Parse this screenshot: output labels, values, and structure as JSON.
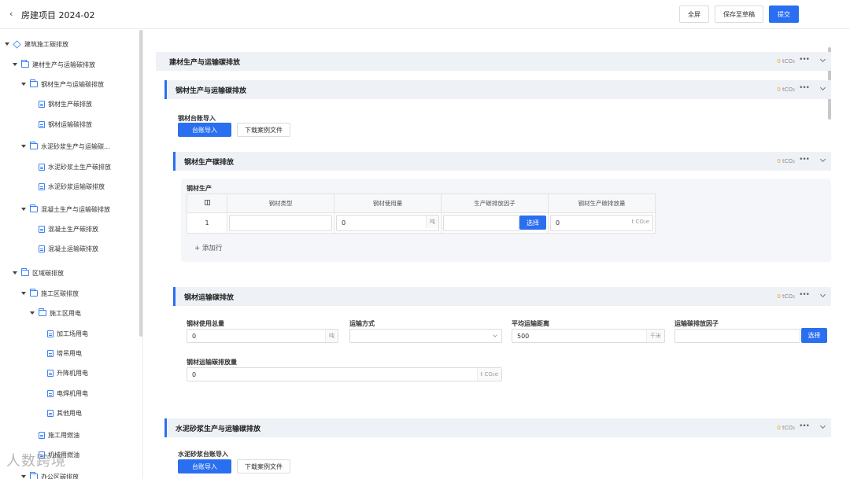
{
  "header": {
    "back_icon": "chevron-left-icon",
    "title": "房建项目 2024-02",
    "fullscreen_label": "全屏",
    "save_draft_label": "保存至草稿",
    "submit_label": "提交",
    "primary_color": "#2a6ff0"
  },
  "sidebar": {
    "items": [
      {
        "label": "建筑施工碳排放",
        "icon": "cube-icon",
        "caret": true
      },
      {
        "label": "建材生产与运输碳排放",
        "icon": "folder-icon",
        "caret": true
      },
      {
        "label": "钢材生产与运输碳排放",
        "icon": "folder-icon",
        "caret": true
      },
      {
        "label": "钢材生产碳排放",
        "icon": "document-icon",
        "caret": false
      },
      {
        "label": "钢材运输碳排放",
        "icon": "document-icon",
        "caret": false
      },
      {
        "label": "水泥砂浆生产与运输碳...",
        "icon": "folder-icon",
        "caret": true
      },
      {
        "label": "水泥砂浆土生产碳排放",
        "icon": "document-icon",
        "caret": false
      },
      {
        "label": "水泥砂浆运输碳排放",
        "icon": "document-icon",
        "caret": false
      },
      {
        "label": "混凝土生产与运输碳排放",
        "icon": "folder-icon",
        "caret": true
      },
      {
        "label": "混凝土生产碳排放",
        "icon": "document-icon",
        "caret": false
      },
      {
        "label": "混凝土运输碳排放",
        "icon": "document-icon",
        "caret": false
      },
      {
        "label": "区域碳排放",
        "icon": "folder-icon",
        "caret": true
      },
      {
        "label": "施工区碳排放",
        "icon": "folder-icon",
        "caret": true
      },
      {
        "label": "施工区用电",
        "icon": "folder-icon",
        "caret": true
      },
      {
        "label": "加工场用电",
        "icon": "document-icon",
        "caret": false
      },
      {
        "label": "塔吊用电",
        "icon": "document-icon",
        "caret": false
      },
      {
        "label": "升降机用电",
        "icon": "document-icon",
        "caret": false
      },
      {
        "label": "电焊机用电",
        "icon": "document-icon",
        "caret": false
      },
      {
        "label": "其他用电",
        "icon": "document-icon",
        "caret": false
      },
      {
        "label": "施工用燃油",
        "icon": "document-icon",
        "caret": false
      },
      {
        "label": "机械用燃油",
        "icon": "document-icon",
        "caret": false
      },
      {
        "label": "办公区碳排放",
        "icon": "folder-icon",
        "caret": true
      }
    ]
  },
  "sections": {
    "s1": {
      "title": "建材生产与运输碳排放",
      "total": "0",
      "unit": "tCO₂"
    },
    "s2": {
      "title": "钢材生产与运输碳排放",
      "total": "0",
      "unit": "tCO₂"
    },
    "s3": {
      "title": "钢材生产碳排放",
      "total": "0",
      "unit": "tCO₂"
    },
    "s4": {
      "title": "钢材运输碳排放",
      "total": "0",
      "unit": "tCO₂"
    },
    "s5": {
      "title": "水泥砂浆生产与运输碳排放",
      "total": "0",
      "unit": "tCO₂"
    }
  },
  "steel_ledger": {
    "label": "钢材台账导入",
    "import_label": "台账导入",
    "download_label": "下载案例文件"
  },
  "steel_production": {
    "sub_label": "钢材生产",
    "columns": [
      "钢材类型",
      "钢材使用量",
      "生产碳排放因子",
      "钢材生产碳排放量"
    ],
    "row": {
      "index": "1",
      "type": "",
      "amount": "0",
      "amount_unit": "吨",
      "factor": "",
      "factor_btn": "选择",
      "emission": "0",
      "emission_unit": "t CO₂e"
    },
    "add_row_label": "+ 添加行"
  },
  "steel_transport": {
    "total_usage_label": "钢材使用总量",
    "total_usage_value": "0",
    "total_usage_unit": "吨",
    "mode_label": "运输方式",
    "mode_value": "",
    "distance_label": "平均运输距离",
    "distance_value": "500",
    "distance_unit": "千米",
    "factor_label": "运输碳排放因子",
    "factor_value": "",
    "factor_btn": "选择",
    "emission_label": "钢材运输碳排放量",
    "emission_value": "0",
    "emission_unit": "t CO₂e"
  },
  "cement_ledger": {
    "label": "水泥砂浆台账导入",
    "import_label": "台账导入",
    "download_label": "下载案例文件"
  },
  "watermark": "人数跨境"
}
